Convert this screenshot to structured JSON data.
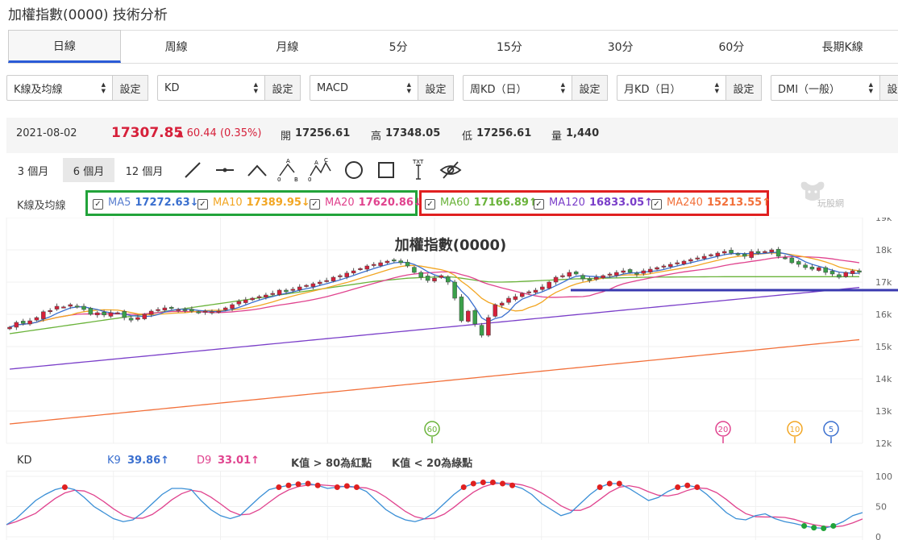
{
  "page_title": "加權指數(0000) 技術分析",
  "tabs": [
    "日線",
    "周線",
    "月線",
    "5分",
    "15分",
    "30分",
    "60分",
    "長期K線"
  ],
  "selectors": [
    {
      "value": "K線及均線",
      "button": "設定"
    },
    {
      "value": "KD",
      "button": "設定"
    },
    {
      "value": "MACD",
      "button": "設定"
    },
    {
      "value": "周KD（日）",
      "button": "設定"
    },
    {
      "value": "月KD（日）",
      "button": "設定"
    },
    {
      "value": "DMI（一般）",
      "button": "設定"
    }
  ],
  "quote": {
    "date": "2021-08-02",
    "price": "17307.85",
    "change": "60.44 (0.35%)",
    "open_label": "開",
    "open": "17256.61",
    "high_label": "高",
    "high": "17348.05",
    "low_label": "低",
    "low": "17256.61",
    "vol_label": "量",
    "vol": "1,440"
  },
  "ranges": [
    "3 個月",
    "6 個月",
    "12 個月"
  ],
  "tool_icons": [
    "line-tool-icon",
    "horizontal-line-icon",
    "angle-tool-icon",
    "abc-pattern-icon",
    "abcd-pattern-icon",
    "circle-tool-icon",
    "rectangle-tool-icon",
    "text-tool-icon",
    "hide-drawings-icon"
  ],
  "txt_tool_label": "TXT",
  "pattern_labels": {
    "a": "A",
    "b": "B",
    "c": "C",
    "zero": "0"
  },
  "ma_label": "K線及均線",
  "ma_items": [
    {
      "name": "MA5",
      "value": "17272.63",
      "arrow": "↓",
      "color": "#3a6fcf",
      "label_color": "#5a7fd0"
    },
    {
      "name": "MA10",
      "value": "17389.95",
      "arrow": "↓",
      "color": "#f2a623",
      "label_color": "#f2a623"
    },
    {
      "name": "MA20",
      "value": "17620.86",
      "arrow": "↓",
      "color": "#e0438e",
      "label_color": "#e0438e"
    },
    {
      "name": "MA60",
      "value": "17166.89",
      "arrow": "↑",
      "color": "#6ab33a",
      "label_color": "#6ab33a"
    },
    {
      "name": "MA120",
      "value": "16833.05",
      "arrow": "↑",
      "color": "#7a3ec9",
      "label_color": "#7a3ec9"
    },
    {
      "name": "MA240",
      "value": "15213.55",
      "arrow": "↑",
      "color": "#f2703a",
      "label_color": "#f2703a"
    }
  ],
  "watermark": "玩股網",
  "kd": {
    "label": "KD",
    "k_label": "K9",
    "k_value": "39.86",
    "k_arrow": "↑",
    "d_label": "D9",
    "d_value": "33.01",
    "d_arrow": "↑",
    "note1": "K值 > 80為紅點",
    "note2": "K值 < 20為綠點"
  },
  "colors": {
    "up": "#d6203a",
    "down": "#3aa04a",
    "accent": "#2a5bd7",
    "green_box": "#22a33a",
    "red_box": "#e02020",
    "ref_line": "#3a3ab0"
  },
  "chart_data": {
    "type": "candlestick",
    "title": "加權指數(0000)",
    "y_ticks": [
      "19k",
      "18k",
      "17k",
      "16k",
      "15k",
      "14k",
      "13k",
      "12k"
    ],
    "ylim": [
      12000,
      19000
    ],
    "kd_ticks": [
      "100",
      "50",
      "0"
    ],
    "markers": [
      {
        "label": "60"
      },
      {
        "label": "20"
      },
      {
        "label": "10"
      },
      {
        "label": "5"
      }
    ],
    "marker_colors": [
      "#6ab33a",
      "#e0438e",
      "#f2a623",
      "#3a6fcf"
    ],
    "reference_line": 16750,
    "close": [
      15600,
      15750,
      15720,
      15800,
      15900,
      16080,
      16120,
      16250,
      16230,
      16300,
      16250,
      16150,
      16000,
      16050,
      15980,
      16050,
      16050,
      15900,
      15820,
      15900,
      16000,
      16100,
      16150,
      16200,
      16180,
      16150,
      16120,
      16100,
      16050,
      16100,
      16080,
      16100,
      16200,
      16300,
      16400,
      16450,
      16500,
      16550,
      16600,
      16650,
      16750,
      16700,
      16780,
      16850,
      16900,
      16950,
      17000,
      17050,
      17150,
      17200,
      17280,
      17350,
      17420,
      17500,
      17550,
      17600,
      17650,
      17680,
      17600,
      17500,
      17300,
      17150,
      17050,
      17120,
      17200,
      17000,
      16500,
      15800,
      16100,
      15700,
      15350,
      15900,
      16300,
      16350,
      16500,
      16550,
      16650,
      16700,
      16750,
      16850,
      17000,
      17150,
      17200,
      17300,
      17250,
      17100,
      17050,
      17150,
      17200,
      17250,
      17300,
      17350,
      17300,
      17250,
      17350,
      17400,
      17450,
      17500,
      17550,
      17600,
      17650,
      17700,
      17750,
      17800,
      17850,
      17900,
      17950,
      17900,
      17850,
      17800,
      17950,
      17900,
      17950,
      18000,
      17800,
      17750,
      17600,
      17550,
      17450,
      17400,
      17450,
      17300,
      17250,
      17150,
      17300,
      17350,
      17308
    ],
    "ma60": [
      15400,
      15430,
      15460,
      15490,
      15520,
      15550,
      15580,
      15610,
      15640,
      15670,
      15700,
      15730,
      15760,
      15790,
      15820,
      15850,
      15880,
      15910,
      15940,
      15970,
      16000,
      16030,
      16060,
      16090,
      16120,
      16150,
      16180,
      16210,
      16240,
      16270,
      16300,
      16330,
      16360,
      16390,
      16420,
      16450,
      16480,
      16510,
      16540,
      16570,
      16600,
      16630,
      16660,
      16690,
      16720,
      16750,
      16780,
      16810,
      16840,
      16870,
      16900,
      16930,
      16960,
      16990,
      17020,
      17040,
      17060,
      17080,
      17100,
      17120,
      17130,
      17140,
      17150,
      17155,
      17160,
      17165,
      17150,
      17120,
      17090,
      17060,
      17030,
      17010,
      17000,
      17000,
      17005,
      17010,
      17020,
      17030,
      17040,
      17050,
      17060,
      17070,
      17080,
      17090,
      17100,
      17105,
      17110,
      17115,
      17120,
      17125,
      17130,
      17135,
      17140,
      17145,
      17150,
      17152,
      17154,
      17156,
      17158,
      17160,
      17161,
      17162,
      17163,
      17164,
      17165,
      17166,
      17167,
      17167,
      17167,
      17167,
      17167,
      17167,
      17167,
      17167,
      17167,
      17167,
      17167,
      17167,
      17167,
      17167,
      17167,
      17167,
      17167,
      17167,
      17167,
      17167,
      17167
    ],
    "ma120_start": 14300,
    "ma120_end": 16833,
    "ma240_start": 12600,
    "ma240_end": 15214,
    "k": [
      20,
      30,
      45,
      60,
      70,
      78,
      82,
      78,
      65,
      50,
      40,
      30,
      25,
      28,
      40,
      55,
      70,
      80,
      80,
      78,
      60,
      45,
      35,
      30,
      35,
      50,
      65,
      78,
      82,
      85,
      87,
      88,
      85,
      80,
      82,
      84,
      82,
      75,
      60,
      45,
      35,
      28,
      25,
      30,
      40,
      55,
      70,
      82,
      88,
      90,
      90,
      88,
      85,
      80,
      70,
      55,
      45,
      35,
      40,
      55,
      70,
      82,
      88,
      88,
      80,
      70,
      60,
      65,
      75,
      82,
      85,
      82,
      70,
      55,
      40,
      30,
      28,
      35,
      38,
      30,
      25,
      22,
      18,
      15,
      14,
      18,
      25,
      35,
      40
    ]
  }
}
